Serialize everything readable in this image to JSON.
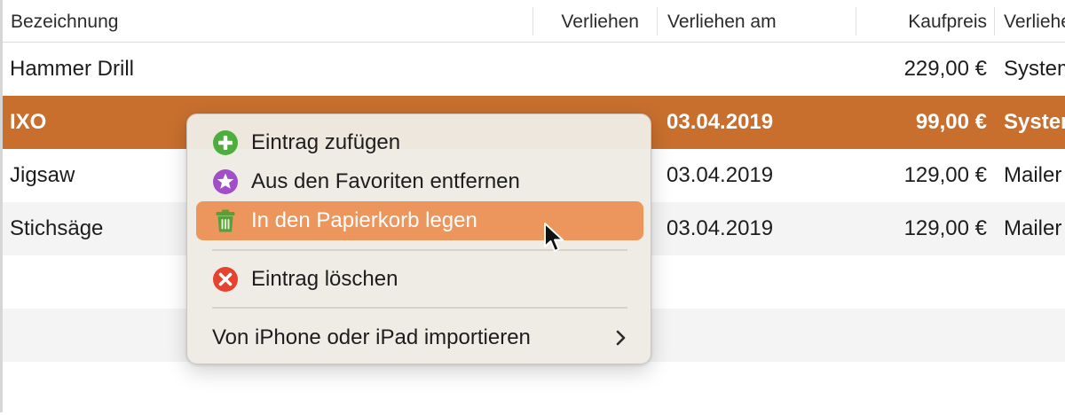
{
  "table": {
    "columns": [
      "Bezeichnung",
      "Verliehen",
      "Verliehen am",
      "Kaufpreis",
      "Verliehen an"
    ],
    "rows": [
      {
        "name": "Hammer Drill",
        "lent": "",
        "lent_on": "",
        "price": "229,00 €",
        "lent_to": "System"
      },
      {
        "name": "IXO",
        "lent": "",
        "lent_on": "03.04.2019",
        "price": "99,00 €",
        "lent_to": "System"
      },
      {
        "name": "Jigsaw",
        "lent": "",
        "lent_on": "03.04.2019",
        "price": "129,00 €",
        "lent_to": "Mailer"
      },
      {
        "name": "Stichsäge",
        "lent": "",
        "lent_on": "03.04.2019",
        "price": "129,00 €",
        "lent_to": "Mailer"
      }
    ],
    "selected_row": 1
  },
  "context_menu": {
    "items": [
      {
        "label": "Eintrag zufügen",
        "icon": "plus-circle-icon",
        "color": "#4caf3c"
      },
      {
        "label": "Aus den Favoriten entfernen",
        "icon": "star-circle-icon",
        "color": "#a24dc9"
      },
      {
        "label": "In den Papierkorb legen",
        "icon": "trash-icon",
        "color": "#5a9e3a",
        "highlighted": true
      },
      {
        "label": "Eintrag löschen",
        "icon": "x-circle-icon",
        "color": "#e5432f"
      },
      {
        "label": "Von iPhone oder iPad importieren",
        "icon": "chevron-right-icon",
        "submenu": true
      }
    ]
  },
  "colors": {
    "selection": "#c86f2e",
    "menu_highlight": "#ec955c"
  }
}
